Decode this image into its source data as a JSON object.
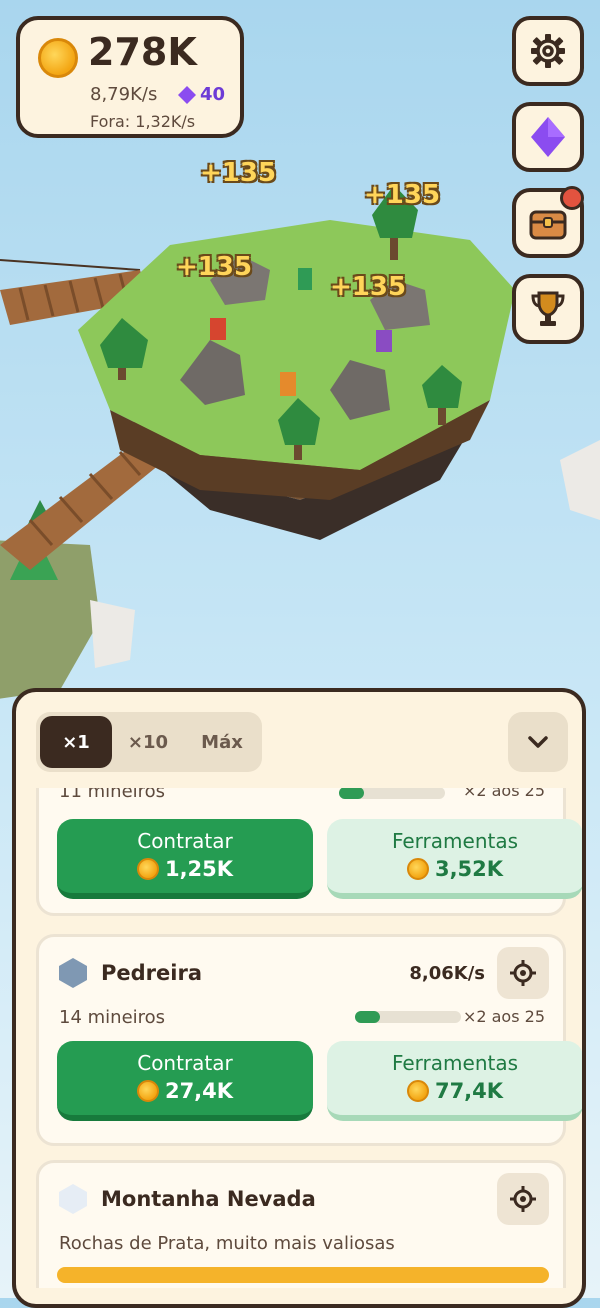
{
  "hud": {
    "coins": "278K",
    "rate": "8,79K/s",
    "gems": "40",
    "offline": "Fora: 1,32K/s"
  },
  "side_buttons": [
    "gear-icon",
    "gem-icon",
    "chest-icon",
    "trophy-icon"
  ],
  "floating_rewards": [
    "+135",
    "+135",
    "+135",
    "+135"
  ],
  "colors": {
    "hire": "#259c52",
    "tools_bg": "#ddf2e4",
    "panel": "#fdf3df",
    "dark": "#3b2a20",
    "gem": "#8b4cf0"
  },
  "panel": {
    "tabs": [
      "×1",
      "×10",
      "Máx"
    ],
    "active_tab": "×1",
    "cards": [
      {
        "subtitle": "11 mineiros",
        "multiplier": "×2 aos 25",
        "hire_label": "Contratar",
        "hire_price": "1,25K",
        "tools_label": "Ferramentas",
        "tools_price": "3,52K"
      },
      {
        "title": "Pedreira",
        "rate": "8,06K/s",
        "subtitle": "14 mineiros",
        "progress": 0.24,
        "multiplier": "×2 aos 25",
        "hire_label": "Contratar",
        "hire_price": "27,4K",
        "tools_label": "Ferramentas",
        "tools_price": "77,4K"
      },
      {
        "title": "Montanha Nevada",
        "subtitle": "Rochas de Prata, muito mais valiosas"
      }
    ]
  }
}
